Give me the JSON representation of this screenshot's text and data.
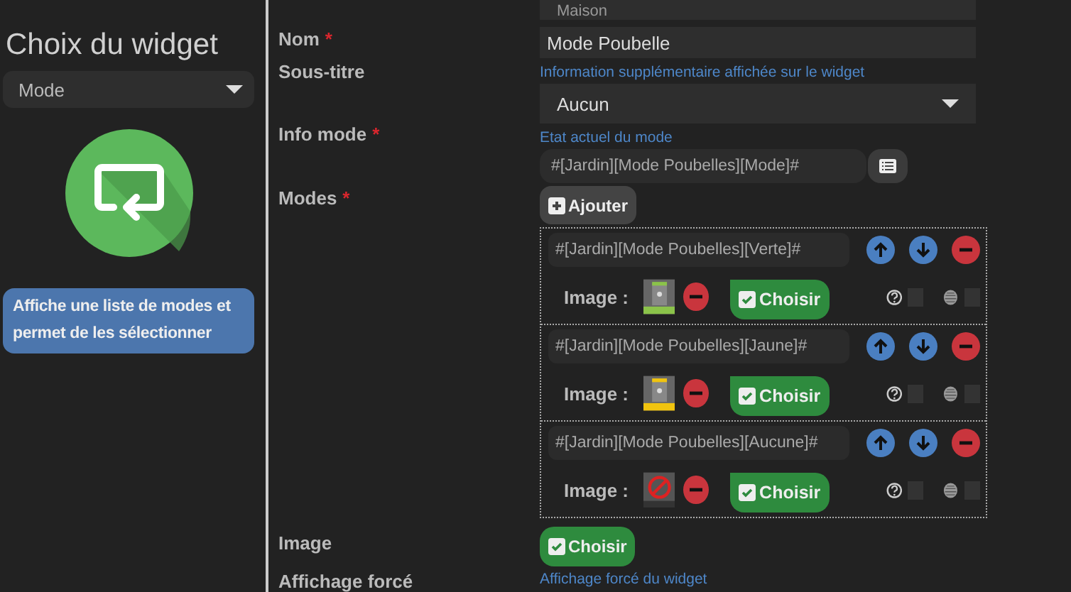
{
  "sidebar": {
    "title": "Choix du widget",
    "widget_select": "Mode",
    "description": "Affiche une liste de modes et permet de les sélectionner"
  },
  "form": {
    "top_select": "Maison",
    "fields": [
      {
        "kind": "text",
        "label": "Nom",
        "required_mark": "*",
        "value": "Mode Poubelle"
      },
      {
        "kind": "select",
        "label": "Sous-titre",
        "hint": "Information supplémentaire affichée sur le widget",
        "value": "Aucun"
      },
      {
        "kind": "command",
        "label": "Info mode",
        "required_mark": "*",
        "hint": "Etat actuel du mode",
        "value": "#[Jardin][Mode Poubelles][Mode]#"
      },
      {
        "kind": "modes",
        "label": "Modes",
        "required_mark": "*",
        "add_label": "Ajouter"
      },
      {
        "kind": "image",
        "label": "Image",
        "choose_label": "Choisir"
      },
      {
        "kind": "hint",
        "label": "Affichage forcé",
        "hint": "Affichage forcé du widget"
      }
    ],
    "modes": [
      {
        "command": "#[Jardin][Mode Poubelles][Verte]#",
        "image_label": "Image :",
        "kind": "green-bin",
        "choose_label": "Choisir",
        "help_checked": false,
        "hidden_checked": false
      },
      {
        "command": "#[Jardin][Mode Poubelles][Jaune]#",
        "image_label": "Image :",
        "kind": "yellow-bin",
        "choose_label": "Choisir",
        "help_checked": false,
        "hidden_checked": false
      },
      {
        "command": "#[Jardin][Mode Poubelles][Aucune]#",
        "image_label": "Image :",
        "kind": "no-bin",
        "choose_label": "Choisir",
        "help_checked": false,
        "hidden_checked": false
      }
    ]
  }
}
